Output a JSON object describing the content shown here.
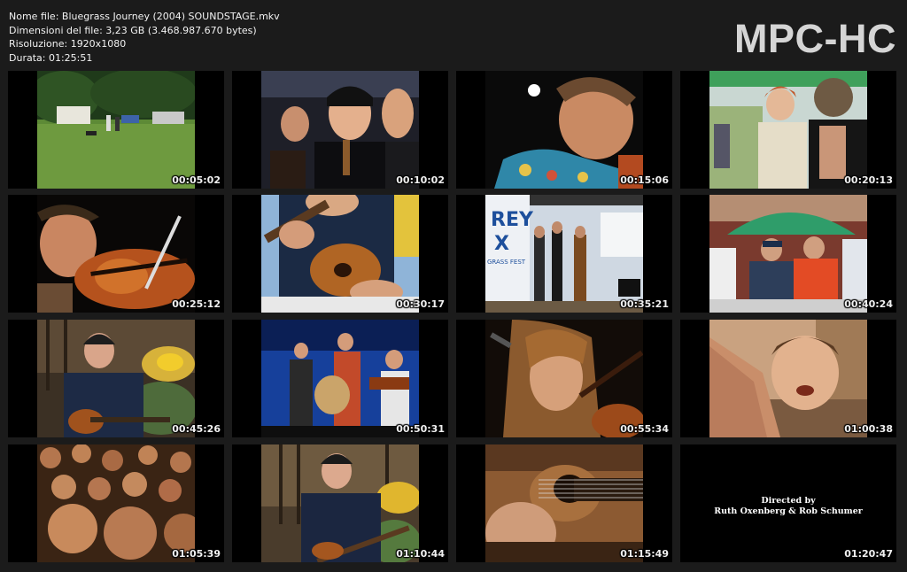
{
  "header": {
    "filename": "Nome file: Bluegrass Journey (2004) SOUNDSTAGE.mkv",
    "filesize": "Dimensioni del file: 3,23 GB (3.468.987.670 bytes)",
    "resolution": "Risoluzione: 1920x1080",
    "duration": "Durata: 01:25:51",
    "logo": "MPC-HC"
  },
  "thumbnails": [
    {
      "time": "00:05:02",
      "scene": "campground-field"
    },
    {
      "time": "00:10:02",
      "scene": "singers-close-up"
    },
    {
      "time": "00:15:06",
      "scene": "singer-hawaiian-shirt"
    },
    {
      "time": "00:20:13",
      "scene": "festival-crowd-conversation"
    },
    {
      "time": "00:25:12",
      "scene": "fiddler-close-up"
    },
    {
      "time": "00:30:17",
      "scene": "mandolin-player"
    },
    {
      "time": "00:35:21",
      "scene": "band-on-festival-stage"
    },
    {
      "time": "00:40:24",
      "scene": "fans-under-umbrella"
    },
    {
      "time": "00:45:26",
      "scene": "mandolin-player-garden"
    },
    {
      "time": "00:50:31",
      "scene": "young-band-on-stage"
    },
    {
      "time": "00:55:34",
      "scene": "woman-playing-fiddle"
    },
    {
      "time": "01:00:38",
      "scene": "man-singing-close-up"
    },
    {
      "time": "01:05:39",
      "scene": "audience-crowd"
    },
    {
      "time": "01:10:44",
      "scene": "mandolin-player-garden-2"
    },
    {
      "time": "01:15:49",
      "scene": "guitar-close-up"
    },
    {
      "time": "01:20:47",
      "scene": "end-credits"
    }
  ],
  "credits": {
    "line1": "Directed by",
    "line2": "Ruth Oxenberg & Rob Schumer"
  }
}
